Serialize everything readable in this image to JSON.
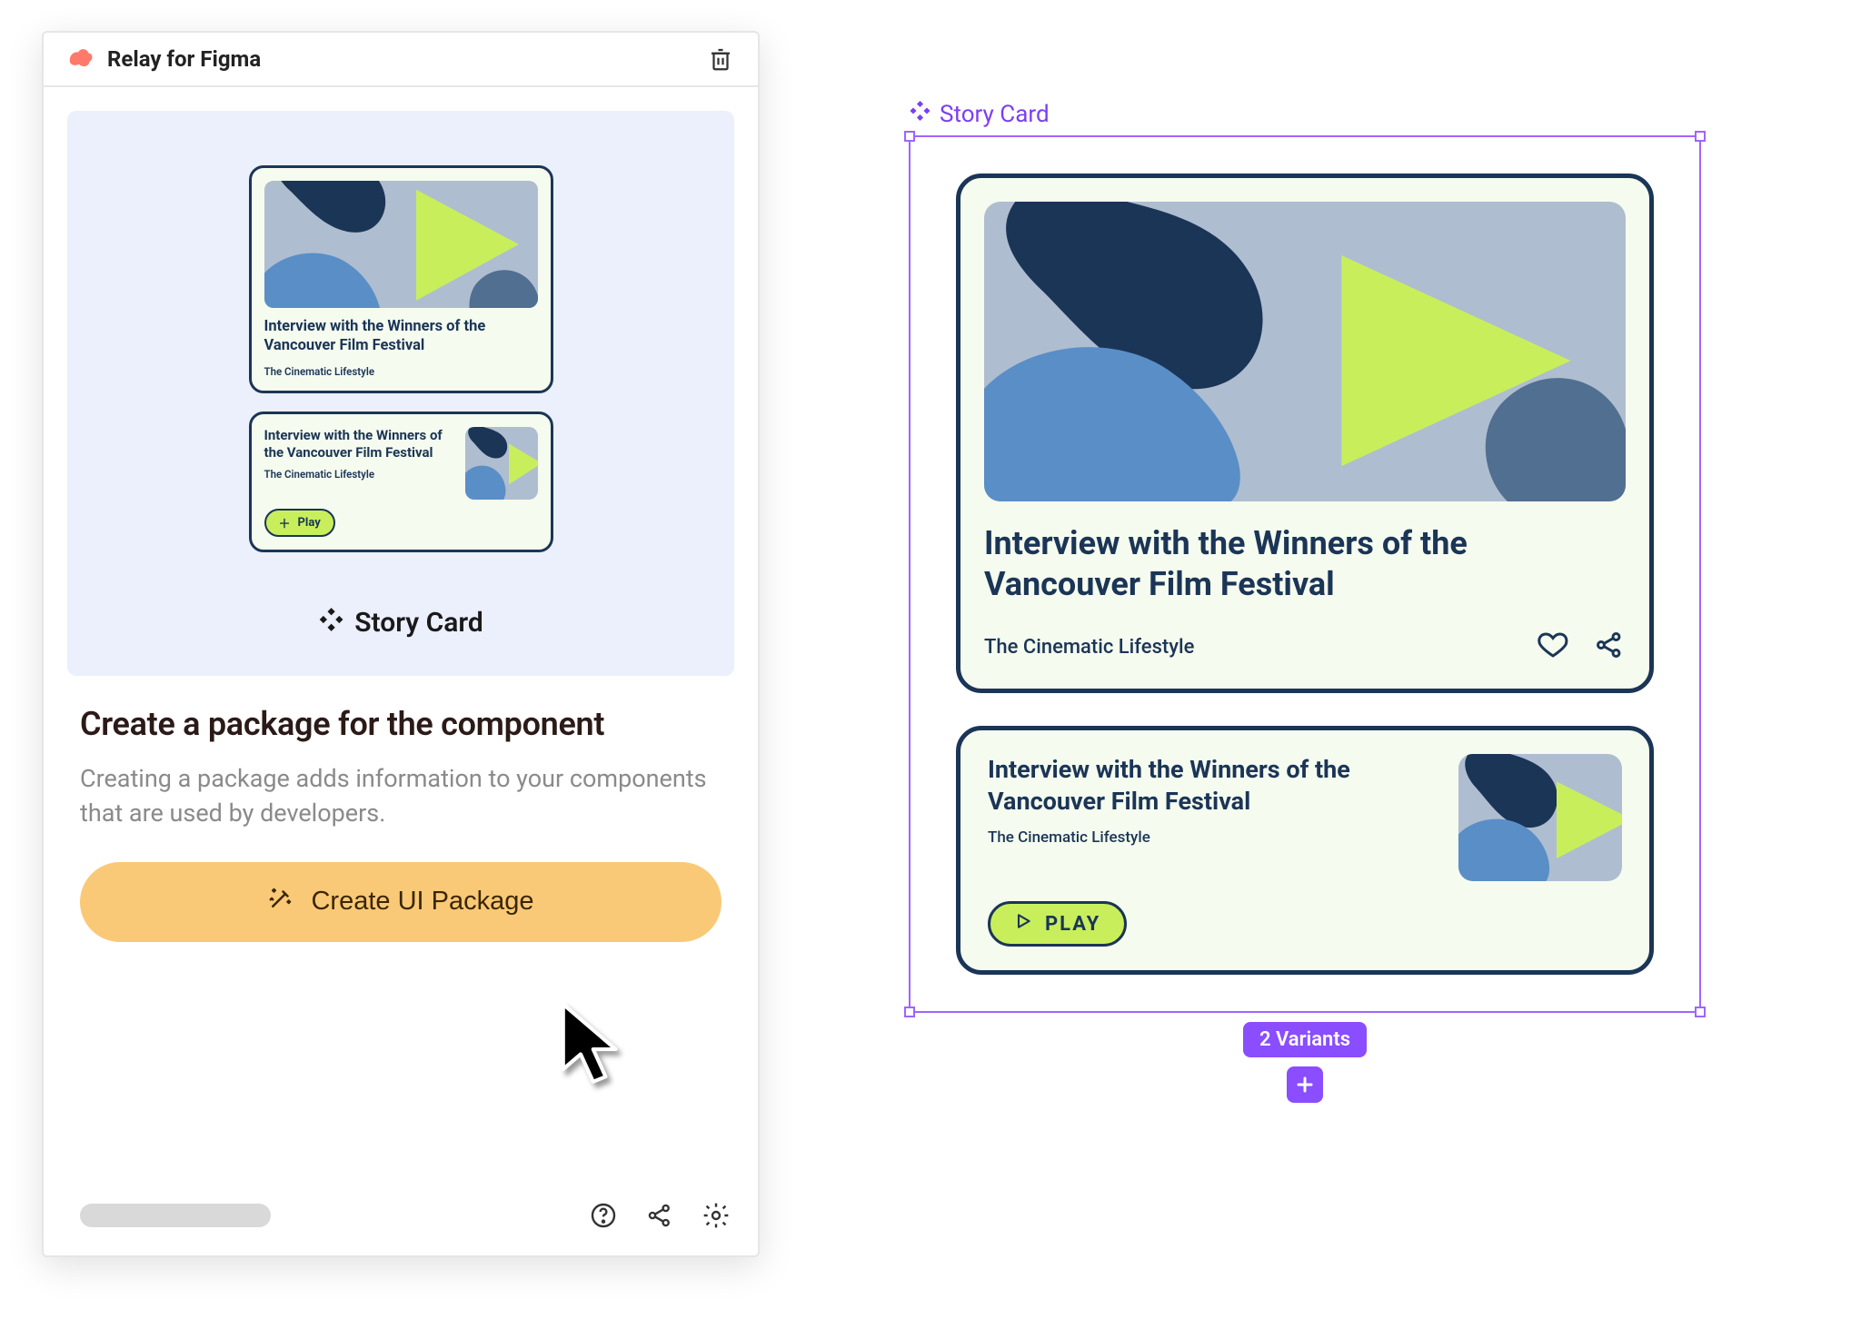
{
  "plugin": {
    "title": "Relay for Figma",
    "component_name": "Story Card",
    "heading": "Create a package for the component",
    "description": "Creating a package adds information to your components that are used by developers.",
    "create_button": "Create UI Package"
  },
  "preview_cards": {
    "card1": {
      "title": "Interview with the Winners of the Vancouver Film Festival",
      "subtitle": "The Cinematic Lifestyle"
    },
    "card2": {
      "title": "Interview with the Winners of the Vancouver Film Festival",
      "subtitle": "The Cinematic Lifestyle",
      "play_label": "Play"
    }
  },
  "canvas": {
    "frame_label": "Story Card",
    "variants_chip": "2 Variants"
  },
  "story_card_large": {
    "title": "Interview with the Winners of the Vancouver Film Festival",
    "subtitle": "The Cinematic Lifestyle"
  },
  "story_card_small": {
    "title": "Interview with the Winners of the Vancouver Film Festival",
    "subtitle": "The Cinematic Lifestyle",
    "play_label": "PLAY"
  },
  "colors": {
    "navy": "#1b3556",
    "cream": "#f5fbef",
    "lime": "#c8ef5b",
    "figma_purple": "#8a4dff",
    "create_btn": "#fac977",
    "panel_bg": "#eceffc"
  }
}
